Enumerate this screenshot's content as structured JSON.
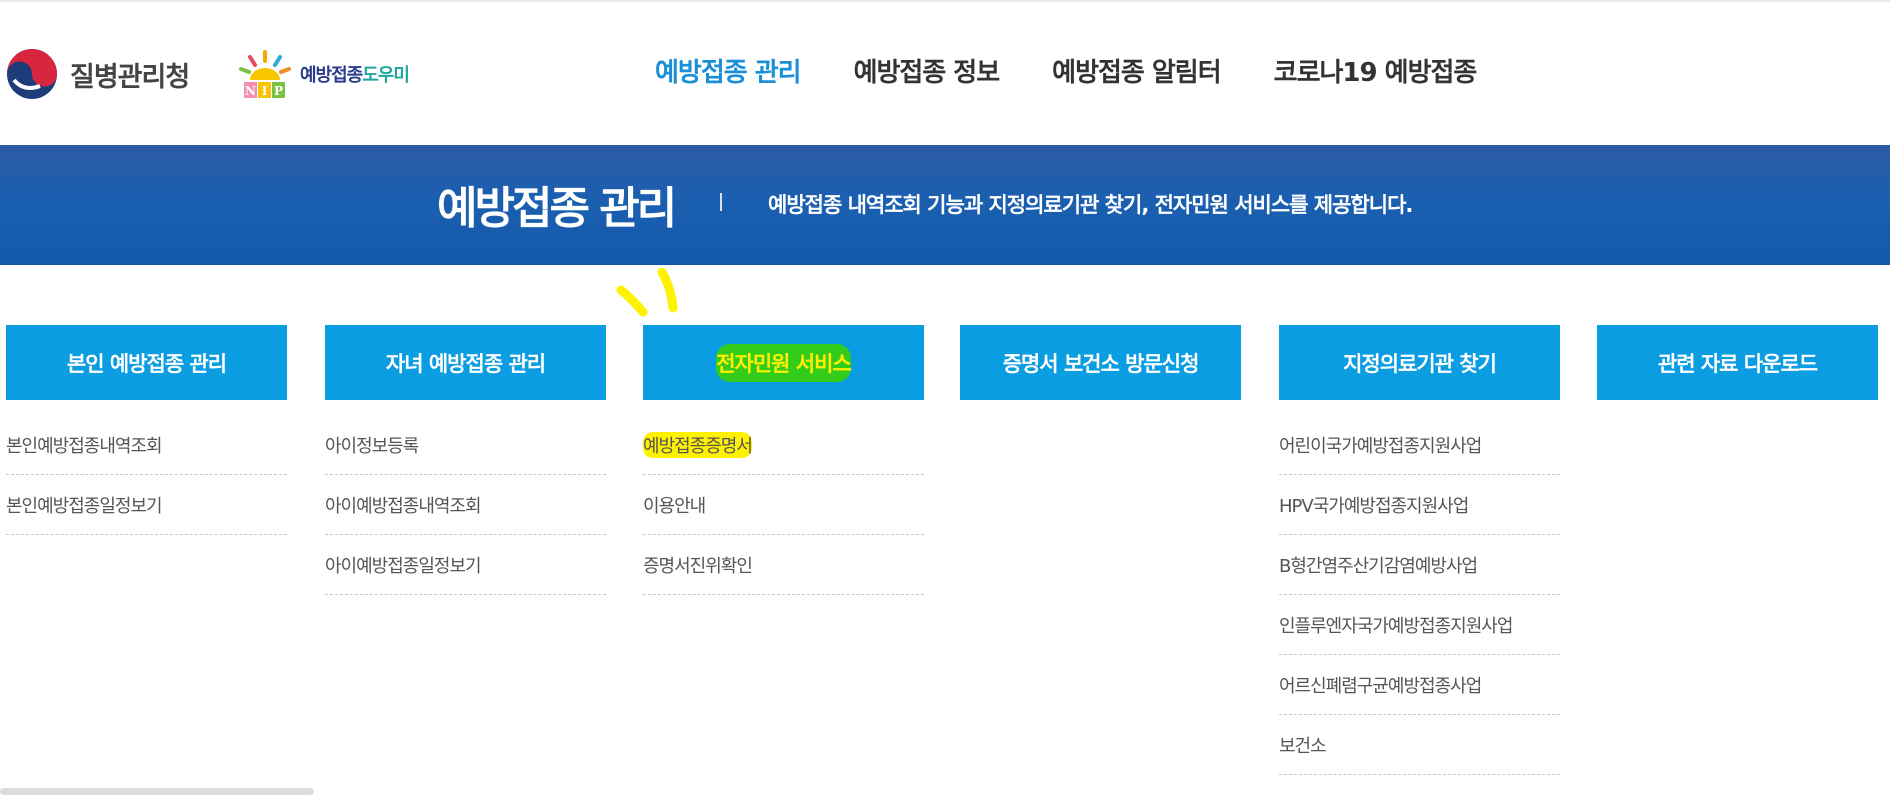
{
  "header": {
    "org_name": "질병관리청",
    "helper_name_part1": "예방접종",
    "helper_name_part2": "도우미",
    "helper_logo_letters": "NIP",
    "nav": [
      {
        "label": "예방접종 관리",
        "active": true
      },
      {
        "label": "예방접종 정보",
        "active": false
      },
      {
        "label": "예방접종 알림터",
        "active": false
      },
      {
        "label": "코로나19 예방접종",
        "active": false
      }
    ]
  },
  "banner": {
    "title": "예방접종 관리",
    "description": "예방접종 내역조회 기능과 지정의료기관 찾기, 전자민원 서비스를 제공합니다."
  },
  "columns": [
    {
      "title": "본인 예방접종 관리",
      "items": [
        "본인예방접종내역조회",
        "본인예방접종일정보기"
      ]
    },
    {
      "title": "자녀 예방접종 관리",
      "items": [
        "아이정보등록",
        "아이예방접종내역조회",
        "아이예방접종일정보기"
      ]
    },
    {
      "title": "전자민원 서비스",
      "items": [
        "예방접종증명서",
        "이용안내",
        "증명서진위확인"
      ]
    },
    {
      "title": "증명서 보건소 방문신청",
      "items": []
    },
    {
      "title": "지정의료기관 찾기",
      "items": [
        "어린이국가예방접종지원사업",
        "HPV국가예방접종지원사업",
        "B형간염주산기감염예방사업",
        "인플루엔자국가예방접종지원사업",
        "어르신폐렴구균예방접종사업",
        "보건소"
      ]
    },
    {
      "title": "관련 자료 다운로드",
      "items": []
    }
  ],
  "colors": {
    "nav_active": "#1a8fd8",
    "banner": "#1b5fb0",
    "menu_head": "#0a9de2",
    "highlight_green": "#33cc1a",
    "highlight_yellow": "#fff200"
  }
}
